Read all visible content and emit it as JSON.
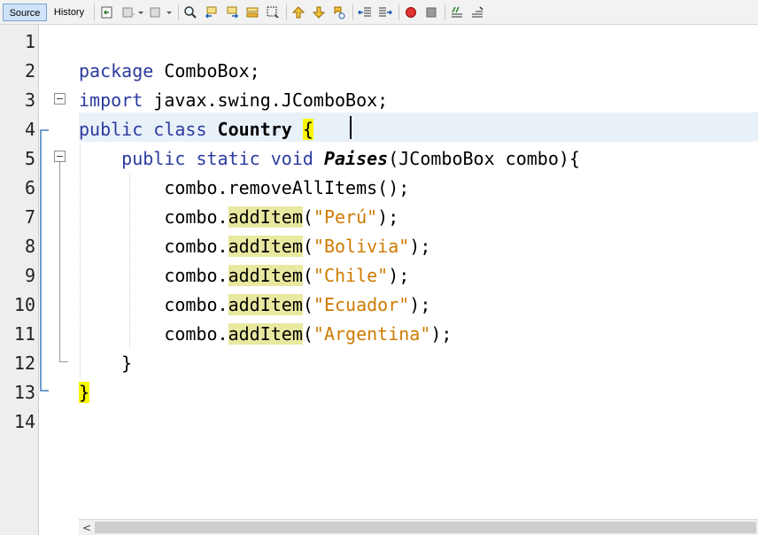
{
  "toolbar": {
    "tabs": [
      {
        "label": "Source",
        "active": true
      },
      {
        "label": "History",
        "active": false
      }
    ],
    "buttons": [
      {
        "name": "last-edit-icon"
      },
      {
        "name": "back-icon"
      },
      {
        "name": "forward-icon"
      },
      {
        "name": "find-icon"
      },
      {
        "name": "find-previous-icon"
      },
      {
        "name": "find-next-icon"
      },
      {
        "name": "toggle-highlight-icon"
      },
      {
        "name": "toggle-rect-selection-icon"
      },
      {
        "name": "previous-bookmark-icon"
      },
      {
        "name": "next-bookmark-icon"
      },
      {
        "name": "toggle-bookmark-icon"
      },
      {
        "name": "shift-left-icon"
      },
      {
        "name": "shift-right-icon"
      },
      {
        "name": "start-macro-icon"
      },
      {
        "name": "stop-macro-icon"
      },
      {
        "name": "comment-icon"
      },
      {
        "name": "uncomment-icon"
      }
    ]
  },
  "editor": {
    "line_numbers": [
      "1",
      "2",
      "3",
      "4",
      "5",
      "6",
      "7",
      "8",
      "9",
      "10",
      "11",
      "12",
      "13",
      "14"
    ],
    "current_line": 4,
    "lines": {
      "l2": {
        "kw": "package",
        "rest": " ComboBox;"
      },
      "l3": {
        "kw": "import",
        "rest": " javax.swing.JComboBox;"
      },
      "l4": {
        "kw": "public class",
        "space": " ",
        "name": "Country",
        "space2": " ",
        "brace": "{"
      },
      "l5": {
        "indent": "    ",
        "kw": "public static void",
        "space": " ",
        "name": "Paises",
        "rest": "(JComboBox combo){"
      },
      "l6": {
        "indent": "        ",
        "rest": "combo.removeAllItems();"
      },
      "l7": {
        "indent": "        ",
        "obj": "combo.",
        "method": "addItem",
        "open": "(",
        "str": "\"Perú\"",
        "close": ");"
      },
      "l8": {
        "indent": "        ",
        "obj": "combo.",
        "method": "addItem",
        "open": "(",
        "str": "\"Bolivia\"",
        "close": ");"
      },
      "l9": {
        "indent": "        ",
        "obj": "combo.",
        "method": "addItem",
        "open": "(",
        "str": "\"Chile\"",
        "close": ");"
      },
      "l10": {
        "indent": "        ",
        "obj": "combo.",
        "method": "addItem",
        "open": "(",
        "str": "\"Ecuador\"",
        "close": ");"
      },
      "l11": {
        "indent": "        ",
        "obj": "combo.",
        "method": "addItem",
        "open": "(",
        "str": "\"Argentina\"",
        "close": ");"
      },
      "l12": {
        "indent": "    ",
        "rest": "}"
      },
      "l13": {
        "brace": "}"
      }
    }
  },
  "scrollbar": {
    "left_arrow": "<"
  },
  "colors": {
    "keyword": "#2c3b9e",
    "string": "#ce7b00",
    "method_highlight": "#e8e8a0",
    "brace_highlight": "#f6f600",
    "current_line": "#e8f0f8"
  }
}
